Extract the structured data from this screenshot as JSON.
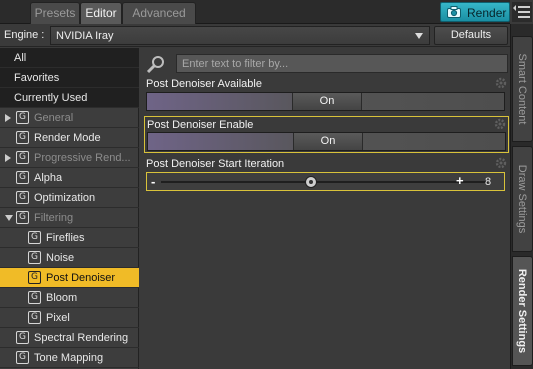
{
  "tabs": [
    {
      "label": "Presets",
      "active": false
    },
    {
      "label": "Editor",
      "active": true
    },
    {
      "label": "Advanced",
      "active": false
    }
  ],
  "render_button": {
    "label": "Render",
    "icon": "camera-icon",
    "color": "#2aa9bd"
  },
  "engine": {
    "label": "Engine :",
    "value": "NVIDIA Iray",
    "defaults_label": "Defaults"
  },
  "nav": {
    "items": [
      {
        "label": "All",
        "style": "dark"
      },
      {
        "label": "Favorites",
        "style": "dark"
      },
      {
        "label": "Currently Used",
        "style": "dark"
      },
      {
        "label": "General",
        "style": "group",
        "expander": "collapsed",
        "dim": true
      },
      {
        "label": "Render Mode",
        "style": "group"
      },
      {
        "label": "Progressive Rend...",
        "style": "group",
        "expander": "collapsed",
        "dim": true
      },
      {
        "label": "Alpha",
        "style": "group"
      },
      {
        "label": "Optimization",
        "style": "group"
      },
      {
        "label": "Filtering",
        "style": "group",
        "expander": "expanded",
        "dim": true
      },
      {
        "label": "Fireflies",
        "style": "child"
      },
      {
        "label": "Noise",
        "style": "child"
      },
      {
        "label": "Post Denoiser",
        "style": "child",
        "selected": true
      },
      {
        "label": "Bloom",
        "style": "child"
      },
      {
        "label": "Pixel",
        "style": "child"
      },
      {
        "label": "Spectral Rendering",
        "style": "group"
      },
      {
        "label": "Tone Mapping",
        "style": "group"
      }
    ],
    "group_icon_glyph": "G",
    "selected_color": "#f0bb27"
  },
  "filter": {
    "placeholder": "Enter text to filter by..."
  },
  "properties": [
    {
      "label": "Post Denoiser Available",
      "value": "On"
    },
    {
      "label": "Post Denoiser Enable",
      "value": "On"
    },
    {
      "label": "Post Denoiser Start Iteration",
      "minus": "-",
      "plus": "+",
      "value": "8"
    }
  ],
  "side_tabs": [
    {
      "label": "Smart Content",
      "active": false
    },
    {
      "label": "Draw Settings",
      "active": false
    },
    {
      "label": "Render Settings",
      "active": true
    }
  ]
}
